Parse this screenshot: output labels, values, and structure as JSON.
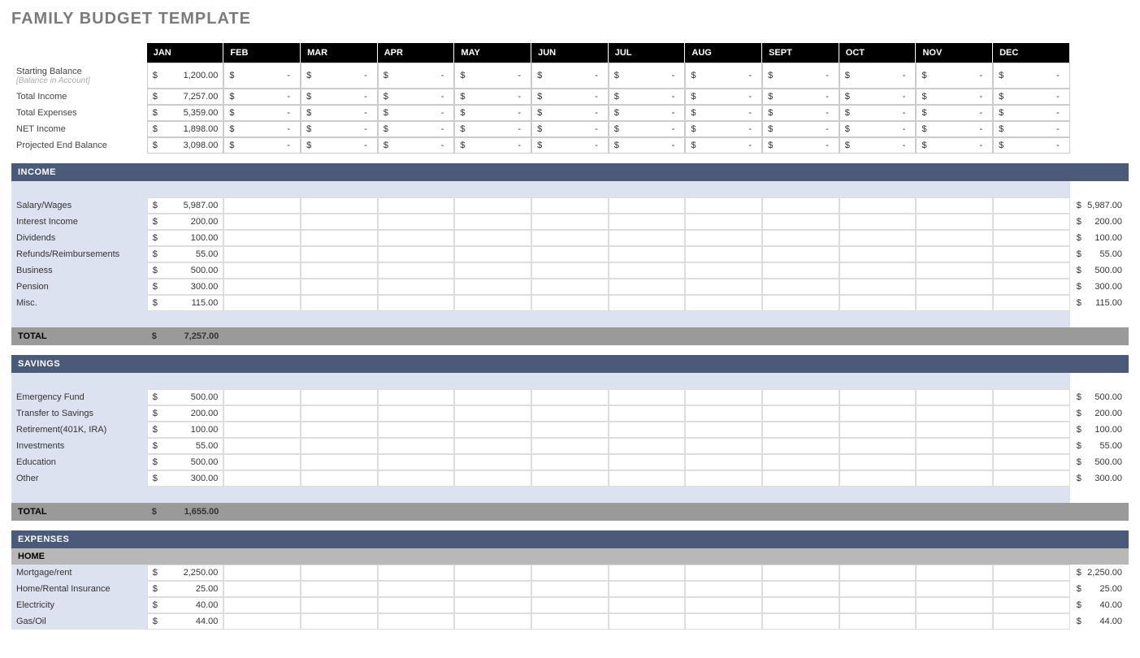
{
  "title": "FAMILY BUDGET TEMPLATE",
  "months": [
    "JAN",
    "FEB",
    "MAR",
    "APR",
    "MAY",
    "JUN",
    "JUL",
    "AUG",
    "SEPT",
    "OCT",
    "NOV",
    "DEC"
  ],
  "summary": [
    {
      "label": "Starting Balance",
      "sublabel": "[Balance in Account]",
      "jan": "1,200.00"
    },
    {
      "label": "Total Income",
      "jan": "7,257.00"
    },
    {
      "label": "Total Expenses",
      "jan": "5,359.00"
    },
    {
      "label": "NET Income",
      "jan": "1,898.00"
    },
    {
      "label": "Projected End Balance",
      "jan": "3,098.00"
    }
  ],
  "sections": [
    {
      "name": "INCOME",
      "rows": [
        {
          "label": "Salary/Wages",
          "jan": "5,987.00",
          "total": "5,987.00"
        },
        {
          "label": "Interest Income",
          "jan": "200.00",
          "total": "200.00"
        },
        {
          "label": "Dividends",
          "jan": "100.00",
          "total": "100.00"
        },
        {
          "label": "Refunds/Reimbursements",
          "jan": "55.00",
          "total": "55.00"
        },
        {
          "label": "Business",
          "jan": "500.00",
          "total": "500.00"
        },
        {
          "label": "Pension",
          "jan": "300.00",
          "total": "300.00"
        },
        {
          "label": "Misc.",
          "jan": "115.00",
          "total": "115.00"
        }
      ],
      "janTotal": "7,257.00"
    },
    {
      "name": "SAVINGS",
      "rows": [
        {
          "label": "Emergency Fund",
          "jan": "500.00",
          "total": "500.00"
        },
        {
          "label": "Transfer to Savings",
          "jan": "200.00",
          "total": "200.00"
        },
        {
          "label": "Retirement(401K, IRA)",
          "jan": "100.00",
          "total": "100.00"
        },
        {
          "label": "Investments",
          "jan": "55.00",
          "total": "55.00"
        },
        {
          "label": "Education",
          "jan": "500.00",
          "total": "500.00"
        },
        {
          "label": "Other",
          "jan": "300.00",
          "total": "300.00"
        }
      ],
      "janTotal": "1,655.00"
    },
    {
      "name": "EXPENSES",
      "subheader": "HOME",
      "rows": [
        {
          "label": "Mortgage/rent",
          "jan": "2,250.00",
          "total": "2,250.00"
        },
        {
          "label": "Home/Rental Insurance",
          "jan": "25.00",
          "total": "25.00"
        },
        {
          "label": "Electricity",
          "jan": "40.00",
          "total": "40.00"
        },
        {
          "label": "Gas/Oil",
          "jan": "44.00",
          "total": "44.00"
        }
      ]
    }
  ],
  "totalLabel": "TOTAL",
  "currency": "$"
}
